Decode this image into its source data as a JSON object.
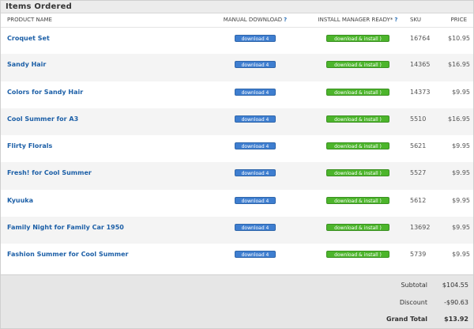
{
  "section": {
    "title": "Items Ordered"
  },
  "columns": {
    "product_name": "PRODUCT NAME",
    "manual_download": "MANUAL DOWNLOAD",
    "install_manager": "INSTALL MANAGER READY*",
    "sku": "SKU",
    "price": "PRICE",
    "help": "?"
  },
  "items": [
    {
      "name": "Croquet Set",
      "download": "download 4",
      "install": "download & install )",
      "sku": "16764",
      "price": "$10.95"
    },
    {
      "name": "Sandy Hair",
      "download": "download 4",
      "install": "download & install )",
      "sku": "14365",
      "price": "$16.95"
    },
    {
      "name": "Colors for Sandy Hair",
      "download": "download 4",
      "install": "download & install )",
      "sku": "14373",
      "price": "$9.95"
    },
    {
      "name": "Cool Summer for A3",
      "download": "download 4",
      "install": "download & install )",
      "sku": "5510",
      "price": "$16.95"
    },
    {
      "name": "Flirty Florals",
      "download": "download 4",
      "install": "download & install )",
      "sku": "5621",
      "price": "$9.95"
    },
    {
      "name": "Fresh! for Cool Summer",
      "download": "download 4",
      "install": "download & install )",
      "sku": "5527",
      "price": "$9.95"
    },
    {
      "name": "Kyuuka",
      "download": "download 4",
      "install": "download & install )",
      "sku": "5612",
      "price": "$9.95"
    },
    {
      "name": "Family Night for Family Car 1950",
      "download": "download 4",
      "install": "download & install )",
      "sku": "13692",
      "price": "$9.95"
    },
    {
      "name": "Fashion Summer for Cool Summer",
      "download": "download 4",
      "install": "download & install )",
      "sku": "5739",
      "price": "$9.95"
    }
  ],
  "totals": {
    "subtotal_label": "Subtotal",
    "subtotal": "$104.55",
    "discount_label": "Discount",
    "discount": "-$90.63",
    "grand_label": "Grand Total",
    "grand": "$13.92"
  },
  "colors": {
    "link": "#1c5fa7",
    "download_button": "#3e7ed0",
    "install_button": "#4cb52b",
    "totals_bg": "#e6e6e6"
  }
}
